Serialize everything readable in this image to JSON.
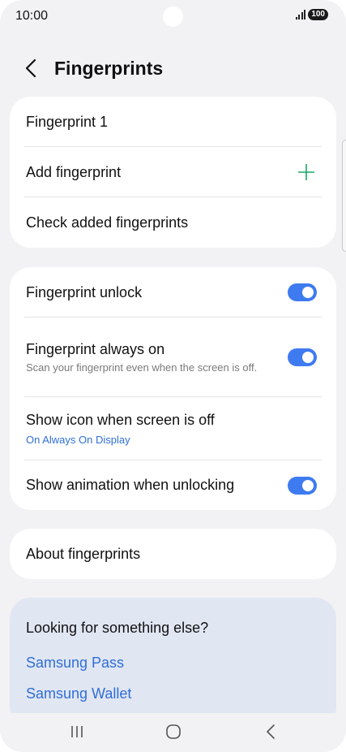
{
  "status_bar": {
    "time": "10:00",
    "battery": "100",
    "icons": [
      "signal-icon"
    ]
  },
  "header": {
    "title": "Fingerprints",
    "back_icon": "chevron-left-icon"
  },
  "fingerprints_card": {
    "items": [
      {
        "label": "Fingerprint 1"
      },
      {
        "label": "Add fingerprint",
        "icon": "plus-icon"
      },
      {
        "label": "Check added fingerprints"
      }
    ]
  },
  "settings_card": {
    "items": [
      {
        "label": "Fingerprint unlock",
        "toggle": true
      },
      {
        "label": "Fingerprint always on",
        "sub": "Scan your fingerprint even when the screen is off.",
        "toggle": true
      },
      {
        "label": "Show icon when screen is off",
        "sub": "On Always On Display"
      },
      {
        "label": "Show animation when unlocking",
        "toggle": true
      }
    ]
  },
  "about_card": {
    "label": "About fingerprints"
  },
  "suggestions": {
    "title": "Looking for something else?",
    "links": [
      "Samsung Pass",
      "Samsung Wallet"
    ]
  },
  "nav_bar": {
    "icons": [
      "recent-apps-icon",
      "home-icon",
      "back-icon"
    ]
  },
  "colors": {
    "accent": "#3e7bf0",
    "link": "#2f6fd6",
    "add_icon": "#1aa56a",
    "background": "#f2f2f4"
  }
}
